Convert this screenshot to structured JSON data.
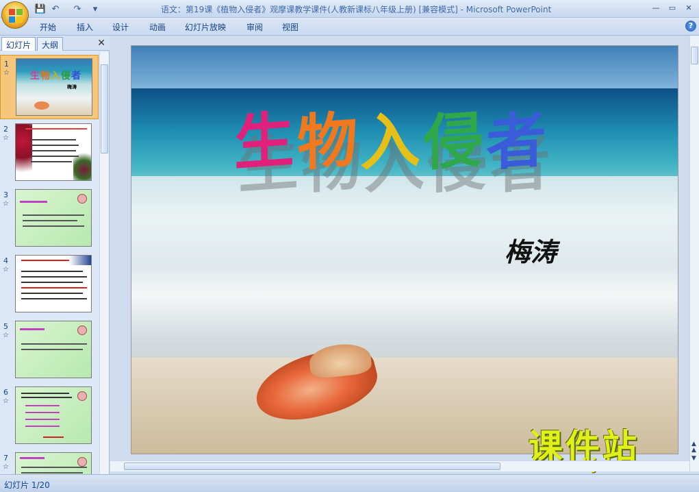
{
  "window": {
    "title": "语文：第19课《植物入侵者》观摩课教学课件(人教新课标八年级上册) [兼容模式] - ",
    "app_name": "Microsoft PowerPoint",
    "quick_access": [
      "save-icon",
      "undo-icon",
      "redo-icon",
      "customize-icon"
    ],
    "controls": [
      "minimize-icon",
      "maximize-icon",
      "close-icon"
    ]
  },
  "ribbon": {
    "tabs": [
      "开始",
      "插入",
      "设计",
      "动画",
      "幻灯片放映",
      "审阅",
      "视图"
    ]
  },
  "panel": {
    "tab_slides": "幻灯片",
    "tab_outline": "大纲",
    "close": "✕",
    "thumbnails": [
      {
        "num": "1",
        "selected": true
      },
      {
        "num": "2",
        "selected": false
      },
      {
        "num": "3",
        "selected": false
      },
      {
        "num": "4",
        "selected": false
      },
      {
        "num": "5",
        "selected": false
      },
      {
        "num": "6",
        "selected": false
      },
      {
        "num": "7",
        "selected": false
      }
    ]
  },
  "slide": {
    "title_chars": [
      "生",
      "物",
      "入",
      "侵",
      "者"
    ],
    "title_colors": [
      "#e0207a",
      "#f0781e",
      "#f0c81e",
      "#2ea84a",
      "#3a5cd8"
    ],
    "author": "梅涛",
    "watermark_text": "课件站",
    "watermark_url": "www.kjzhan.com"
  },
  "status": {
    "slide_indicator": "幻灯片 1/20"
  }
}
